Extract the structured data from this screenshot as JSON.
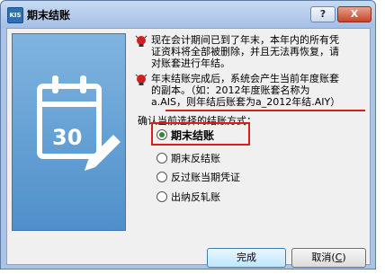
{
  "window": {
    "app_icon_text": "KIS",
    "title": "期末结账"
  },
  "titlebar": {
    "help_label": "?",
    "close_label": "X"
  },
  "illustration": {
    "number": "30"
  },
  "messages": {
    "notice1_lines": [
      "现在会计期间已到了年末，本年内的所有凭",
      "证资料将全部被删除，并且无法再恢复，请",
      "对账套进行年结。"
    ],
    "notice2_lines": [
      "年末结账完成后，系统会产生当前年度账套",
      "的副本。（如：2012年度账套名称为",
      "a.AIS，则年结后账套为a_2012年结.AIY）"
    ]
  },
  "options": {
    "section_label": "确认当前选择的结账方式：",
    "items": [
      {
        "label": "期末结账",
        "checked": true
      },
      {
        "label": "期末反结账",
        "checked": false
      },
      {
        "label": "反过账当期凭证",
        "checked": false
      },
      {
        "label": "出纳反轧账",
        "checked": false
      }
    ]
  },
  "buttons": {
    "ok": "完成",
    "cancel": "取消(",
    "cancel_key": "C",
    "cancel_end": ")"
  },
  "colors": {
    "highlight": "#d91e1e",
    "illustration_bg": "#5d9ad3",
    "radio_dot": "#2a8c2a"
  }
}
